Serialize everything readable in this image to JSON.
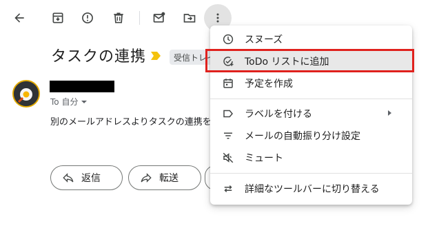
{
  "toolbar": {
    "buttons": [
      "back-icon",
      "archive-icon",
      "report-spam-icon",
      "delete-icon",
      "mark-unread-icon",
      "move-to-icon",
      "more-vert-icon"
    ]
  },
  "email": {
    "subject": "タスクの連携",
    "label": "受信トレイ",
    "to_label": "To 自分",
    "body_preview": "別のメールアドレスよりタスクの連携を"
  },
  "actions": {
    "reply": "返信",
    "forward": "転送"
  },
  "menu": {
    "items": [
      {
        "label": "スヌーズ",
        "icon": "clock-icon"
      },
      {
        "label": "ToDo リストに追加",
        "icon": "add-task-icon"
      },
      {
        "label": "予定を作成",
        "icon": "calendar-icon"
      },
      {
        "label": "ラベルを付ける",
        "icon": "label-icon"
      },
      {
        "label": "メールの自動振り分け設定",
        "icon": "filter-icon"
      },
      {
        "label": "ミュート",
        "icon": "mute-icon"
      },
      {
        "label": "詳細なツールバーに切り替える",
        "icon": "swap-icon"
      }
    ]
  },
  "colors": {
    "highlight_border": "#e0211d",
    "importance_marker": "#f4c20d"
  }
}
